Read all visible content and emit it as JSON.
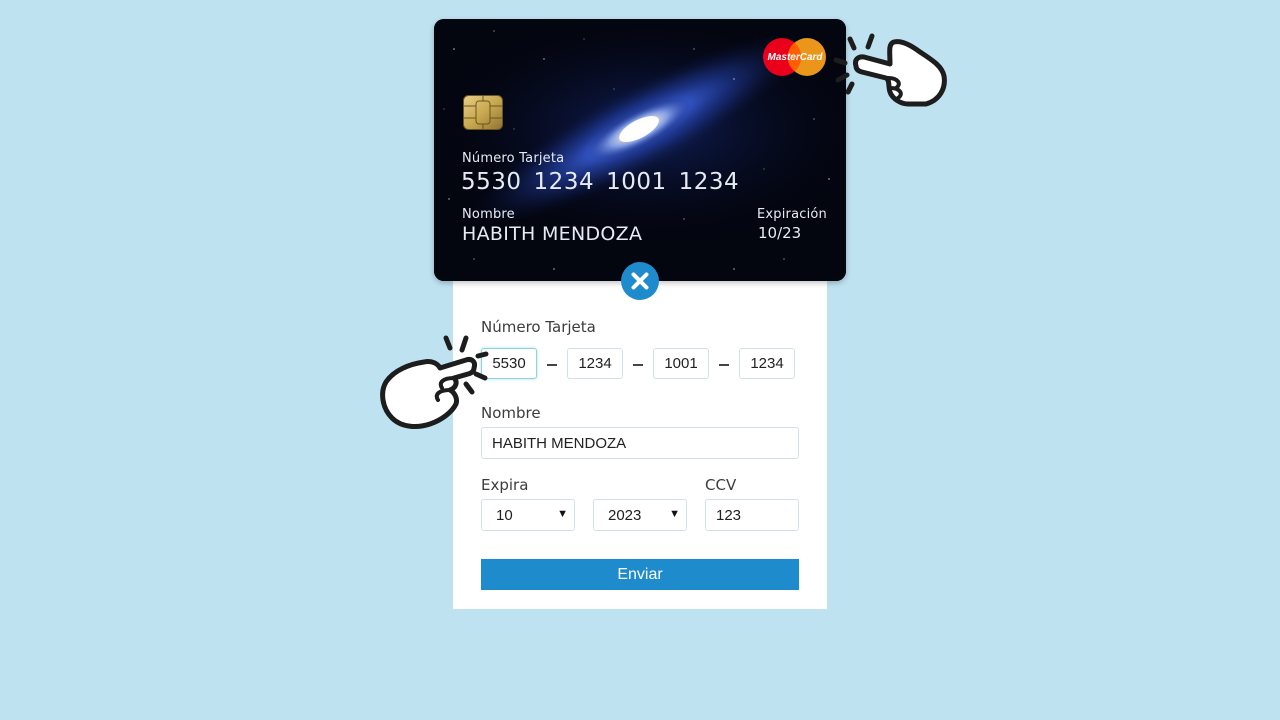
{
  "card": {
    "brand": "MasterCard",
    "number_label": "Número Tarjeta",
    "number_groups": [
      "5530",
      "1234",
      "1001",
      "1234"
    ],
    "name_label": "Nombre",
    "name": "HABITH MENDOZA",
    "expiry_label": "Expiración",
    "expiry": "10/23"
  },
  "form": {
    "number_label": "Número Tarjeta",
    "number_groups": [
      "5530",
      "1234",
      "1001",
      "1234"
    ],
    "name_label": "Nombre",
    "name_value": "HABITH MENDOZA",
    "expiry_label": "Expira",
    "month_value": "10",
    "year_value": "2023",
    "ccv_label": "CCV",
    "ccv_value": "123",
    "submit_label": "Enviar"
  },
  "colors": {
    "background": "#bfe2f1",
    "accent": "#1e8bcd",
    "mastercard_red": "#eb001b",
    "mastercard_orange": "#f79e1b"
  },
  "icons": [
    "chip-icon",
    "mastercard-logo",
    "close-icon",
    "pointing-hand-icon"
  ]
}
